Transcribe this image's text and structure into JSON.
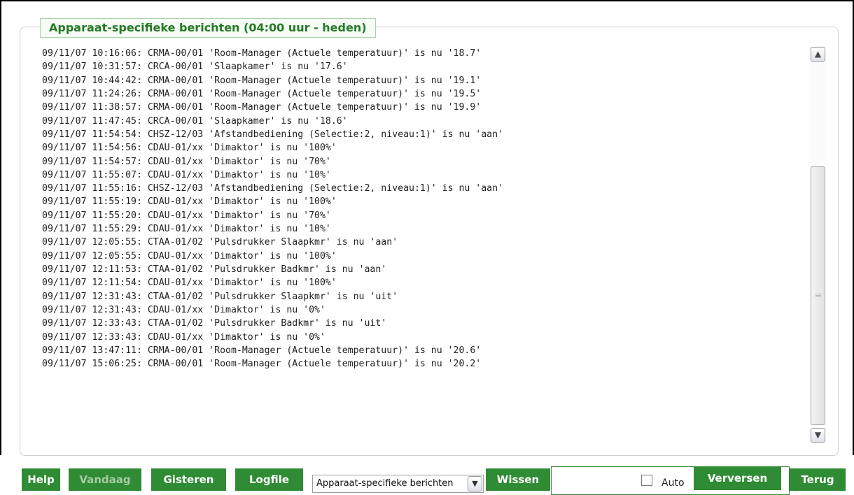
{
  "panel": {
    "title": "Apparaat-specifieke berichten (04:00 uur - heden)"
  },
  "log_lines": [
    "09/11/07 10:16:06: CRMA-00/01 'Room-Manager (Actuele temperatuur)' is nu '18.7'",
    "09/11/07 10:31:57: CRCA-00/01 'Slaapkamer' is nu '17.6'",
    "09/11/07 10:44:42: CRMA-00/01 'Room-Manager (Actuele temperatuur)' is nu '19.1'",
    "09/11/07 11:24:26: CRMA-00/01 'Room-Manager (Actuele temperatuur)' is nu '19.5'",
    "09/11/07 11:38:57: CRMA-00/01 'Room-Manager (Actuele temperatuur)' is nu '19.9'",
    "09/11/07 11:47:45: CRCA-00/01 'Slaapkamer' is nu '18.6'",
    "09/11/07 11:54:54: CHSZ-12/03 'Afstandbediening (Selectie:2, niveau:1)' is nu 'aan'",
    "09/11/07 11:54:56: CDAU-01/xx 'Dimaktor' is nu '100%'",
    "09/11/07 11:54:57: CDAU-01/xx 'Dimaktor' is nu '70%'",
    "09/11/07 11:55:07: CDAU-01/xx 'Dimaktor' is nu '10%'",
    "09/11/07 11:55:16: CHSZ-12/03 'Afstandbediening (Selectie:2, niveau:1)' is nu 'aan'",
    "09/11/07 11:55:19: CDAU-01/xx 'Dimaktor' is nu '100%'",
    "09/11/07 11:55:20: CDAU-01/xx 'Dimaktor' is nu '70%'",
    "09/11/07 11:55:29: CDAU-01/xx 'Dimaktor' is nu '10%'",
    "09/11/07 12:05:55: CTAA-01/02 'Pulsdrukker Slaapkmr' is nu 'aan'",
    "09/11/07 12:05:55: CDAU-01/xx 'Dimaktor' is nu '100%'",
    "09/11/07 12:11:53: CTAA-01/02 'Pulsdrukker Badkmr' is nu 'aan'",
    "09/11/07 12:11:54: CDAU-01/xx 'Dimaktor' is nu '100%'",
    "09/11/07 12:31:43: CTAA-01/02 'Pulsdrukker Slaapkmr' is nu 'uit'",
    "09/11/07 12:31:43: CDAU-01/xx 'Dimaktor' is nu '0%'",
    "09/11/07 12:33:43: CTAA-01/02 'Pulsdrukker Badkmr' is nu 'uit'",
    "09/11/07 12:33:43: CDAU-01/xx 'Dimaktor' is nu '0%'",
    "09/11/07 13:47:11: CRMA-00/01 'Room-Manager (Actuele temperatuur)' is nu '20.6'",
    "09/11/07 15:06:25: CRMA-00/01 'Room-Manager (Actuele temperatuur)' is nu '20.2'"
  ],
  "toolbar": {
    "help": "Help",
    "vandaag": "Vandaag",
    "gisteren": "Gisteren",
    "logfile": "Logfile",
    "dropdown_selected": "Apparaat-specifieke berichten",
    "wissen": "Wissen",
    "auto_label": "Auto",
    "verversen": "Verversen",
    "terug": "Terug"
  },
  "colors": {
    "button_green": "#2f8b34",
    "title_green": "#247a24",
    "inactive_text": "#a7cba7"
  },
  "icons": {
    "scroll_up": "chevron-up-icon",
    "scroll_down": "chevron-down-icon",
    "dropdown": "chevron-down-icon"
  }
}
